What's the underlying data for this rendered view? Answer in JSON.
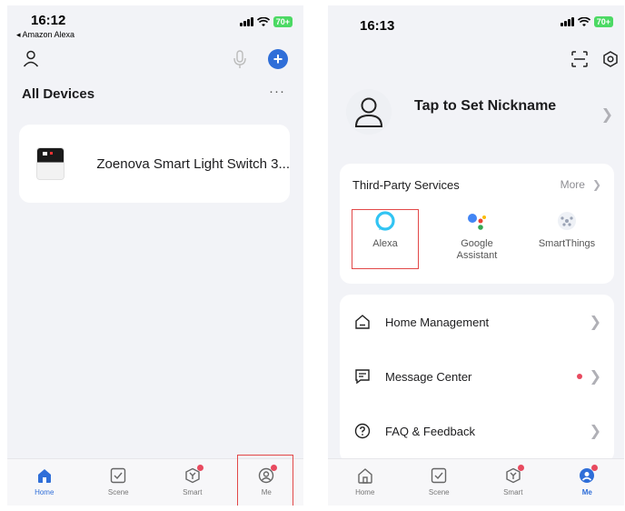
{
  "left": {
    "status_time": "16:12",
    "back_app": "◂ Amazon Alexa",
    "battery": "70+",
    "section_title": "All Devices",
    "more_dots": "···",
    "device_name": "Zoenova Smart Light Switch 3..."
  },
  "right": {
    "status_time": "16:13",
    "battery": "70+",
    "nickname": "Tap to Set Nickname",
    "third_party_title": "Third-Party Services",
    "more_label": "More",
    "services": [
      {
        "label": "Alexa"
      },
      {
        "label": "Google\nAssistant"
      },
      {
        "label": "SmartThings"
      }
    ],
    "menu": [
      {
        "label": "Home Management"
      },
      {
        "label": "Message Center"
      },
      {
        "label": "FAQ & Feedback"
      }
    ]
  },
  "tabs": [
    {
      "label": "Home"
    },
    {
      "label": "Scene"
    },
    {
      "label": "Smart"
    },
    {
      "label": "Me"
    }
  ],
  "colors": {
    "accent": "#2f6ed8",
    "highlight": "#e24848",
    "badge": "#e84a5f",
    "battery": "#4cd964"
  },
  "icons": [
    "person-icon",
    "microphone-icon",
    "add-icon",
    "scan-icon",
    "settings-icon",
    "alexa-icon",
    "google-assistant-icon",
    "smartthings-icon",
    "home-icon",
    "message-icon",
    "help-icon",
    "chevron-right-icon"
  ]
}
